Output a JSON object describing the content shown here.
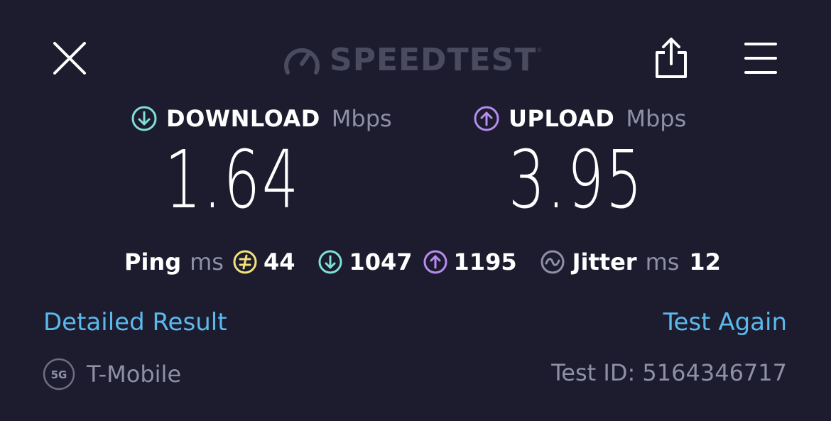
{
  "header": {
    "logo_text": "SPEEDTEST",
    "logo_tm": "®",
    "close_icon": "close-icon",
    "share_icon": "share-icon",
    "menu_icon": "menu-icon"
  },
  "download": {
    "title": "DOWNLOAD",
    "unit": "Mbps",
    "value": "1.64",
    "icon": "download-arrow-icon",
    "color": "#7ee0d6"
  },
  "upload": {
    "title": "UPLOAD",
    "unit": "Mbps",
    "value": "3.95",
    "icon": "upload-arrow-icon",
    "color": "#b78cf0"
  },
  "stats": {
    "ping_label": "Ping",
    "ping_unit": "ms",
    "ping_idle": "44",
    "ping_idle_color": "#f2e27a",
    "ping_download": "1047",
    "ping_upload": "1195",
    "jitter_label": "Jitter",
    "jitter_unit": "ms",
    "jitter_value": "12"
  },
  "links": {
    "detailed_result": "Detailed Result",
    "test_again": "Test Again",
    "link_color": "#5bb9ec"
  },
  "footer": {
    "network_badge": "5G",
    "carrier": "T-Mobile",
    "test_id": "Test ID: 5164346717"
  }
}
